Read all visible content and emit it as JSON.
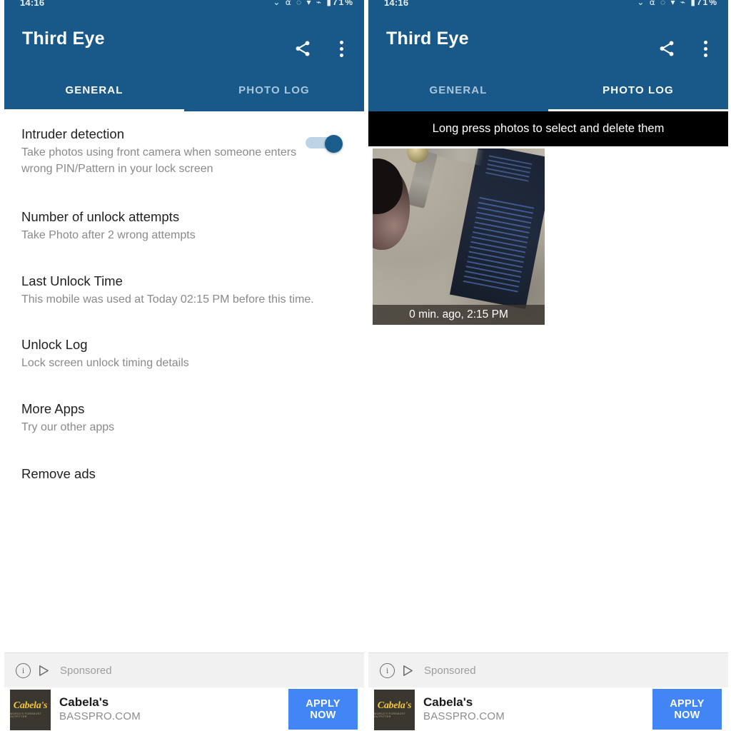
{
  "statusbar": {
    "clock": "14:16",
    "icons": "⌄ ⍺ ◌ ▾ ⌁ ▮",
    "battery": "71%"
  },
  "app": {
    "title": "Third Eye",
    "share_icon": "share-icon",
    "overflow_icon": "overflow-menu-icon"
  },
  "tabs": [
    {
      "label": "GENERAL"
    },
    {
      "label": "PHOTO LOG"
    }
  ],
  "left_panel": {
    "active_tab_index": 0,
    "settings": [
      {
        "title": "Intruder detection",
        "subtitle": "Take photos using front camera when someone enters wrong PIN/Pattern in your lock screen",
        "has_switch": true,
        "switch_on": true
      },
      {
        "title": "Number of unlock attempts",
        "subtitle": "Take Photo after 2 wrong attempts",
        "has_switch": false
      },
      {
        "title": "Last Unlock Time",
        "subtitle": "This mobile was used at Today  02:15 PM before this time.",
        "has_switch": false
      },
      {
        "title": "Unlock Log",
        "subtitle": "Lock screen unlock timing details",
        "has_switch": false
      },
      {
        "title": "More Apps",
        "subtitle": "Try our other apps",
        "has_switch": false
      },
      {
        "title": "Remove ads",
        "subtitle": "",
        "has_switch": false
      }
    ]
  },
  "right_panel": {
    "active_tab_index": 1,
    "hint": "Long press photos to select and delete them",
    "photos": [
      {
        "caption": "0 min. ago, 2:15 PM"
      }
    ]
  },
  "ad": {
    "sponsored_label": "Sponsored",
    "info_glyph": "i",
    "advertiser": "Cabela's",
    "logo_text": "Cabela's",
    "logo_subtext": "World's Foremost Outfitter",
    "domain": "BASSPRO.COM",
    "cta_label": "APPLY NOW"
  },
  "colors": {
    "app_bar_blue": "#185989",
    "switch_thumb": "#1a5c8c",
    "switch_track": "#bcd4e6",
    "cta_blue": "#4285f4",
    "hint_banner": "#000000",
    "sponsored_bg": "#f1f1f1",
    "logo_bg": "#3a3630",
    "logo_yellow": "#f4c43c"
  }
}
